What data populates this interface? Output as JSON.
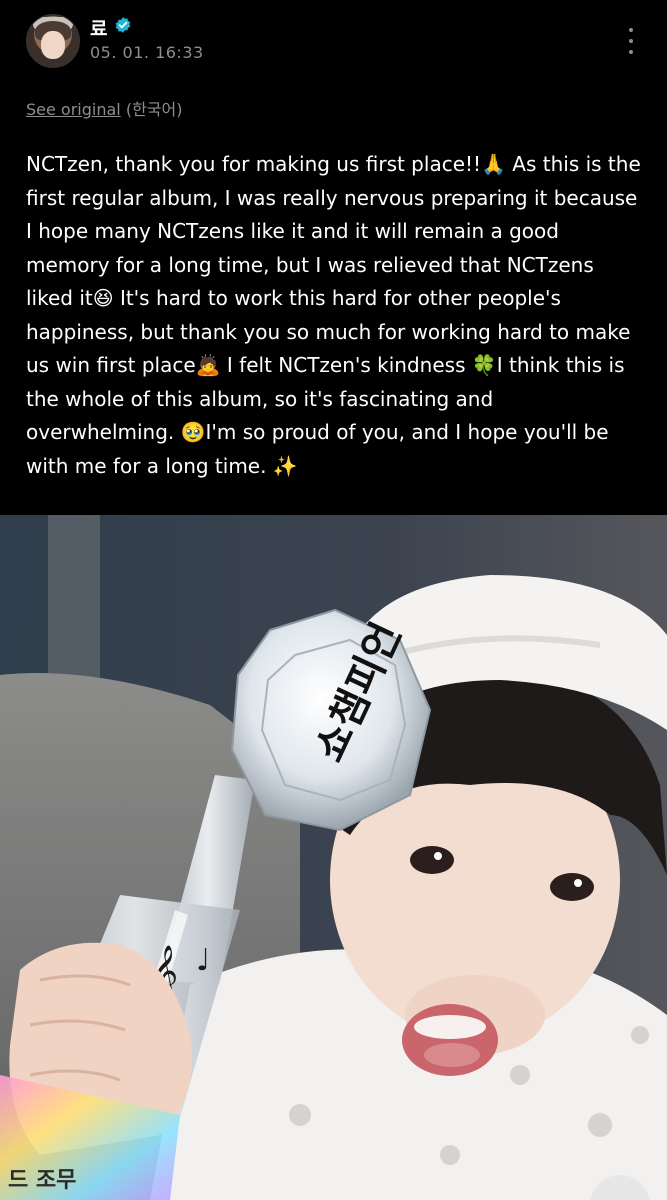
{
  "post": {
    "author": "료",
    "timestamp": "05. 01. 16:33",
    "see_original": "See original",
    "original_language": "(한국어)",
    "body": "NCTzen, thank you for making us first place!!🙏 As this is the first regular album, I was really nervous preparing it because I hope many NCTzens like it and it will remain a good memory for a long time, but I was relieved that NCTzens liked it😆 It's hard to work this hard for other people's happiness, but thank you so much for working hard to make us win first place🙇 I felt NCTzen's kindness 🍀I think this is the whole of this album, so it's fascinating and overwhelming. 🥹I'm so proud of you, and I hope you'll be with me for a long time. ✨"
  },
  "icons": {
    "verified": "verified-badge-icon",
    "more": "more-options-icon"
  },
  "colors": {
    "background": "#000000",
    "verified": "#1fb5d6",
    "meta_text": "#8e8e8e"
  },
  "photo": {
    "trophy_label": "쇼챔피언",
    "base_label": "드 조무"
  }
}
